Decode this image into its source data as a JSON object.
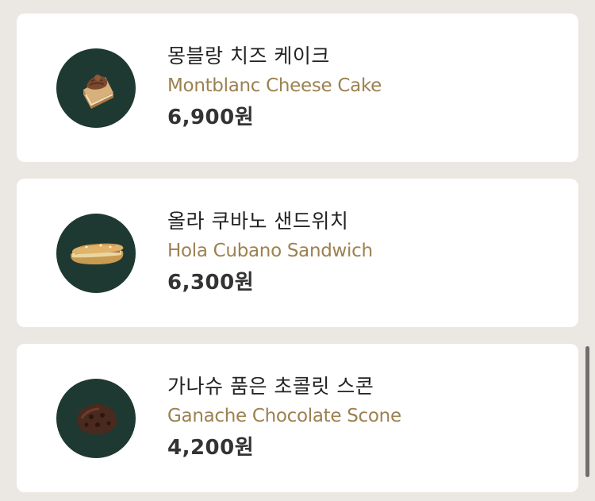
{
  "products": [
    {
      "name_ko": "몽블랑 치즈 케이크",
      "name_en": "Montblanc Cheese Cake",
      "price": "6,900원",
      "icon": "cake-slice-icon"
    },
    {
      "name_ko": "올라 쿠바노 샌드위치",
      "name_en": "Hola Cubano Sandwich",
      "price": "6,300원",
      "icon": "sandwich-icon"
    },
    {
      "name_ko": "가나슈 품은 초콜릿 스콘",
      "name_en": "Ganache Chocolate Scone",
      "price": "4,200원",
      "icon": "scone-icon"
    }
  ],
  "colors": {
    "background": "#ebe7e3",
    "card": "#ffffff",
    "thumb_circle": "#1e3932",
    "english_name": "#9c8150",
    "korean_name": "#222222",
    "price": "#333333"
  }
}
